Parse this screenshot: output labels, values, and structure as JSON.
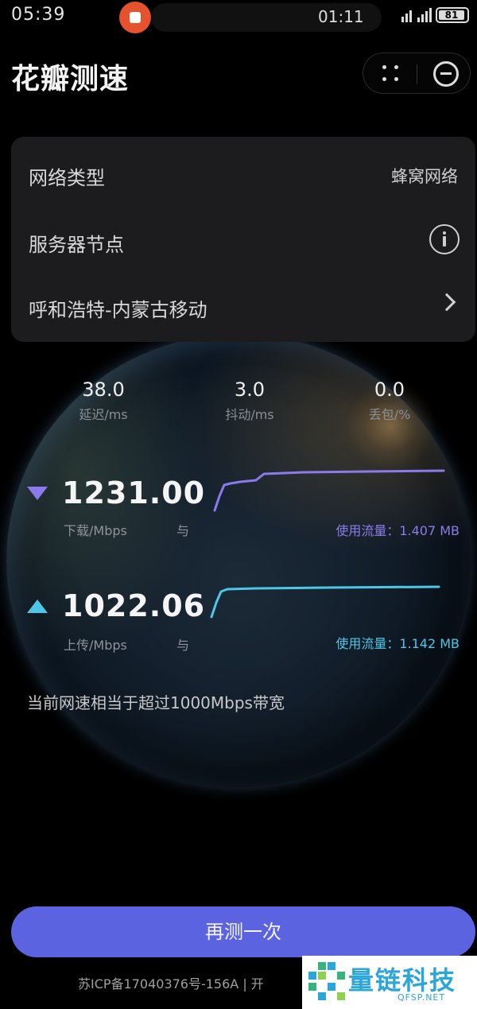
{
  "status_bar": {
    "time": "05:39",
    "recording_timer": "01:11",
    "battery_level": "81"
  },
  "header": {
    "title": "花瓣测速"
  },
  "info": {
    "network_type_label": "网络类型",
    "network_type_value": "蜂窝网络",
    "server_node_label": "服务器节点",
    "server_name": "呼和浩特-内蒙古移动"
  },
  "metrics": [
    {
      "value": "38.0",
      "label": "延迟/ms"
    },
    {
      "value": "3.0",
      "label": "抖动/ms"
    },
    {
      "value": "0.0",
      "label": "丢包/%"
    }
  ],
  "download": {
    "value": "1231.00",
    "label": "下载/Mbps",
    "mark": "与",
    "usage": "使用流量：1.407 MB",
    "color": "#8b7bea"
  },
  "upload": {
    "value": "1022.06",
    "label": "上传/Mbps",
    "mark": "与",
    "usage": "使用流量：1.142 MB",
    "color": "#4ec6e6"
  },
  "note": "当前网速相当于超过1000Mbps带宽",
  "retest_button": "再测一次",
  "footer": "苏ICP备17040376号-156A | 开",
  "watermark": {
    "name": "量链科技",
    "site": "QFSP.NET"
  }
}
